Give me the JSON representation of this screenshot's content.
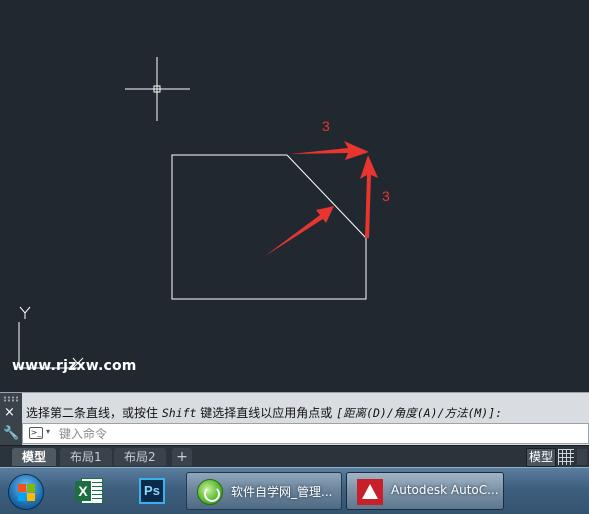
{
  "canvas": {
    "watermark": "www.rjzxw.com",
    "annotations": [
      "3",
      "3"
    ],
    "ucs": {
      "y_label": "Y",
      "x_label": "X"
    }
  },
  "command_line": {
    "prompt_main": "选择第二条直线，或按住",
    "prompt_key": "Shift",
    "prompt_rest": "键选择直线以应用角点或",
    "prompt_options": "[距离(D)/角度(A)/方法(M)]:",
    "input_placeholder": "键入命令",
    "close_symbol": "×",
    "settings_symbol": "🔧",
    "prompt_icon_symbol": ">_",
    "caret_symbol": "▾"
  },
  "layout_tabs": {
    "tabs": [
      {
        "label": "模型",
        "active": true
      },
      {
        "label": "布局1",
        "active": false
      },
      {
        "label": "布局2",
        "active": false
      }
    ],
    "add_label": "+",
    "status_model": "模型"
  },
  "taskbar": {
    "excel_letter": "X",
    "ps_label": "Ps",
    "tasks": [
      {
        "label": "软件自学网_管理..."
      },
      {
        "label": "Autodesk AutoC..."
      }
    ]
  },
  "colors": {
    "canvas_bg": "#212830",
    "annotation_red": "#e8352f",
    "geometry_white": "#ffffff"
  }
}
